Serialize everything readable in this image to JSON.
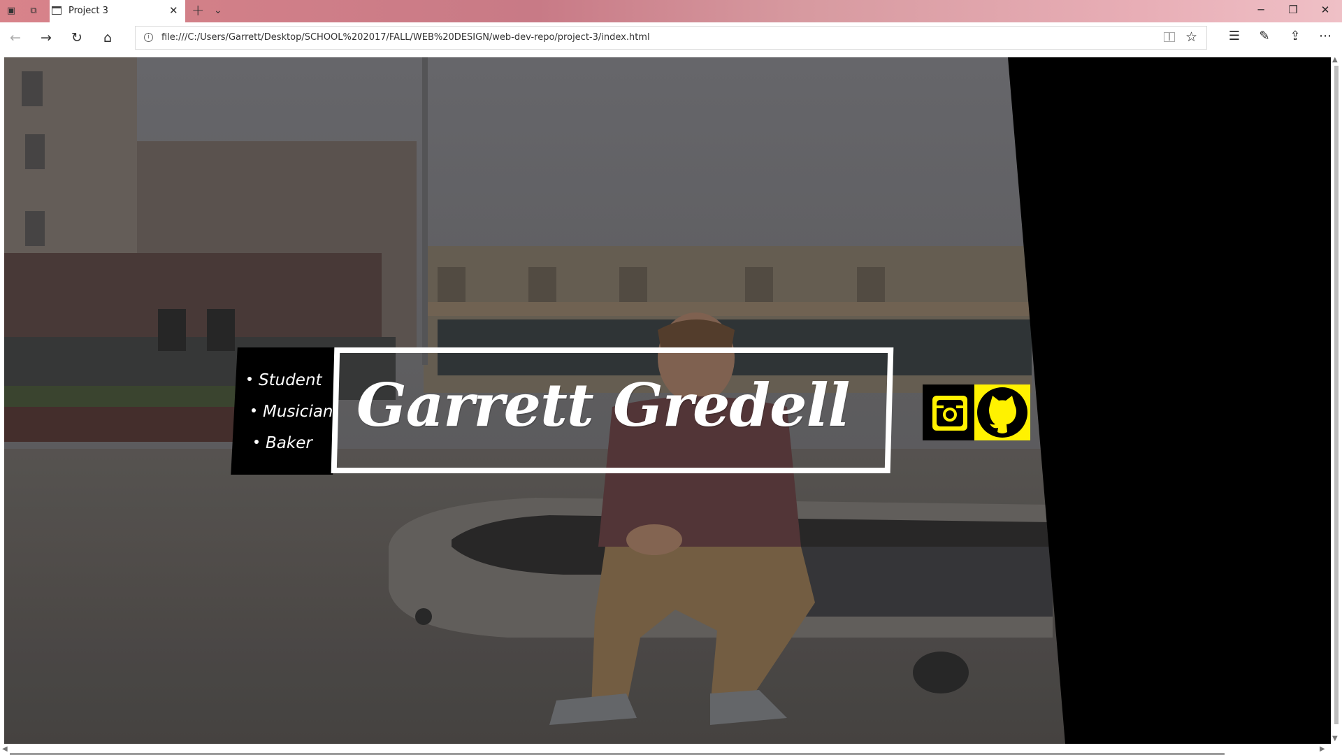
{
  "browser": {
    "tab_title": "Project 3",
    "url": "file:///C:/Users/Garrett/Desktop/SCHOOL%202017/FALL/WEB%20DESIGN/web-dev-repo/project-3/index.html",
    "accent_color": "#d8838a"
  },
  "page": {
    "taglines": [
      "Student",
      "Musician",
      "Baker"
    ],
    "name": "Garrett Gredell",
    "social": [
      {
        "name": "instagram",
        "icon": "instagram-icon",
        "background": "#000000",
        "foreground": "#fff200"
      },
      {
        "name": "github",
        "icon": "github-icon",
        "background": "#fff200",
        "foreground": "#000000"
      }
    ],
    "colors": {
      "text": "#ffffff",
      "accent": "#fff200",
      "panel": "#000000"
    }
  }
}
